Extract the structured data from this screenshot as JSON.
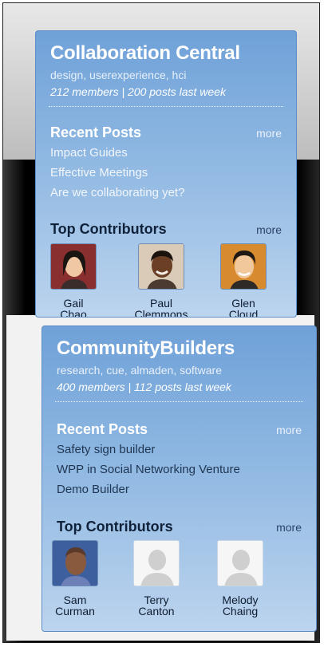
{
  "groups": [
    {
      "title": "Collaboration Central",
      "tags": "design, userexperience, hci",
      "stats": "212 members | 200 posts last week",
      "recent_posts_label": "Recent Posts",
      "recent_more": "more",
      "posts": [
        "Impact Guides",
        "Effective Meetings",
        "Are we collaborating yet?"
      ],
      "top_contributors_label": "Top Contributors",
      "contrib_more": "more",
      "contributors": [
        {
          "first": "Gail",
          "last": "Chao"
        },
        {
          "first": "Paul",
          "last": "Clemmons"
        },
        {
          "first": "Glen",
          "last": "Cloud"
        }
      ]
    },
    {
      "title": "CommunityBuilders",
      "tags": "research, cue, almaden, software",
      "stats": "400 members | 112 posts last week",
      "recent_posts_label": "Recent Posts",
      "recent_more": "more",
      "posts": [
        "Safety sign builder",
        "WPP in Social Networking Venture",
        "Demo Builder"
      ],
      "top_contributors_label": "Top Contributors",
      "contrib_more": "more",
      "contributors": [
        {
          "first": "Sam",
          "last": "Curman"
        },
        {
          "first": "Terry",
          "last": "Canton"
        },
        {
          "first": "Melody",
          "last": "Chaing"
        }
      ]
    }
  ],
  "colors": {
    "card_top": "#6fa1d8",
    "card_bottom": "#bcd4ee",
    "border": "#5e8ec8"
  }
}
